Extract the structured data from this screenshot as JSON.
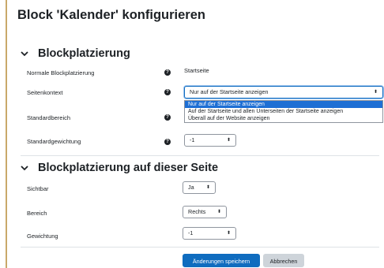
{
  "page_title": "Block 'Kalender' konfigurieren",
  "section1": {
    "title": "Blockplatzierung",
    "fields": {
      "normal_label": "Normale Blockplatzierung",
      "normal_value": "Startseite",
      "context_label": "Seitenkontext",
      "context_value": "Nur auf der Startseite anzeigen",
      "default_region_label": "Standardbereich",
      "default_weight_label": "Standardgewichtung",
      "default_weight_value": "-1"
    },
    "dropdown_options": [
      "Nur auf der Startseite anzeigen",
      "Auf der Startseite und allen Unterseiten der Startseite anzeigen",
      "Überall auf der Website anzeigen"
    ]
  },
  "section2": {
    "title": "Blockplatzierung auf dieser Seite",
    "fields": {
      "visible_label": "Sichtbar",
      "visible_value": "Ja",
      "region_label": "Bereich",
      "region_value": "Rechts",
      "weight_label": "Gewichtung",
      "weight_value": "-1"
    }
  },
  "buttons": {
    "save": "Änderungen speichern",
    "cancel": "Abbrechen"
  },
  "icons": {
    "help": "question-circle-icon",
    "section_toggle": "chevron-down-icon",
    "select_caret": "updown-caret-icon"
  },
  "colors": {
    "primary": "#0f6cbf",
    "selected_option": "#1e6fd4",
    "secondary_button": "#ced4da"
  }
}
